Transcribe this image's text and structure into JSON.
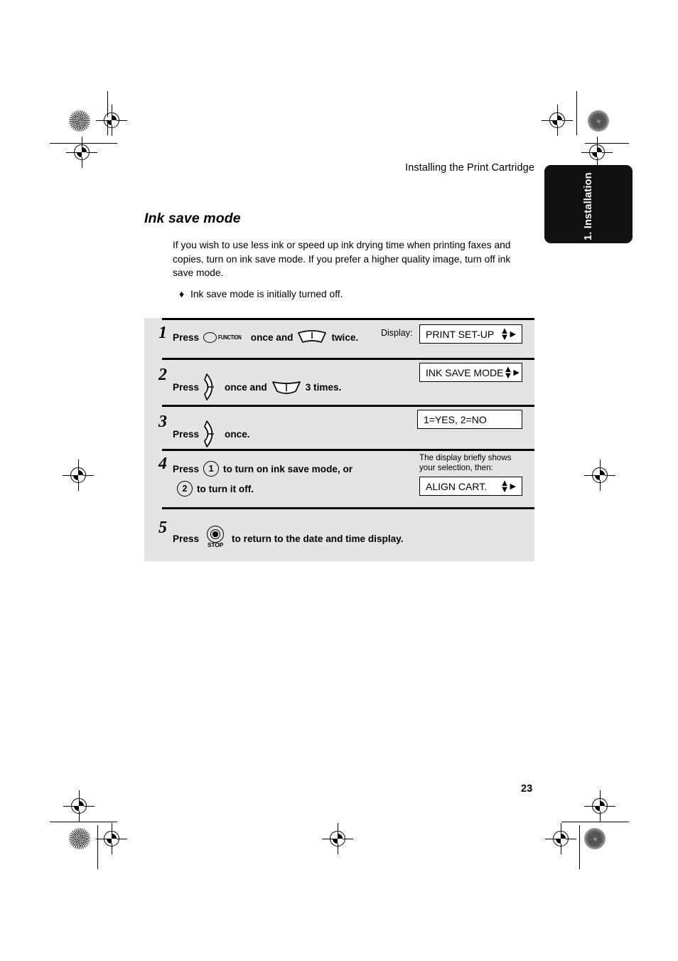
{
  "header": {
    "running_title": "Installing the Print Cartridge"
  },
  "side_tab": {
    "label": "1. Installation",
    "background_color": "#111111",
    "text_color": "#ffffff"
  },
  "section": {
    "title": "Ink save mode",
    "body": "If you wish to use less ink or speed up ink drying time when printing faxes and copies, turn on ink save mode. If you prefer a higher quality image, turn off ink save mode.",
    "bullet_mark": "♦",
    "bullet_text": "Ink save mode is initially turned off."
  },
  "panel": {
    "background_color": "#e4e4e4",
    "display_label": "Display:",
    "steps": [
      {
        "number": "1",
        "press_label": "Press",
        "function_key_label": "FUNCTION",
        "text_after_function": "once and",
        "text_after_arrow": "twice.",
        "lcd": "PRINT SET-UP"
      },
      {
        "number": "2",
        "press_label": "Press",
        "text_after_right_key": "once and",
        "text_after_arrow": "3 times.",
        "lcd": "INK SAVE MODE"
      },
      {
        "number": "3",
        "press_label": "Press",
        "text_after_right_key": "once.",
        "lcd": "1=YES, 2=NO"
      },
      {
        "number": "4",
        "press_label": "Press",
        "key_one": "1",
        "text_after_one": "to turn on ink save mode, or",
        "key_two": "2",
        "text_after_two": "to turn it off.",
        "note": "The display briefly shows\nyour selection, then:",
        "lcd": "ALIGN CART."
      },
      {
        "number": "5",
        "press_label": "Press",
        "stop_key_label": "STOP",
        "text_after_stop": "to return to the date and time display."
      }
    ]
  },
  "footer": {
    "page_number": "23"
  },
  "icons": {
    "arrow_up_down": "▲▼",
    "arrow_right": "▶"
  }
}
